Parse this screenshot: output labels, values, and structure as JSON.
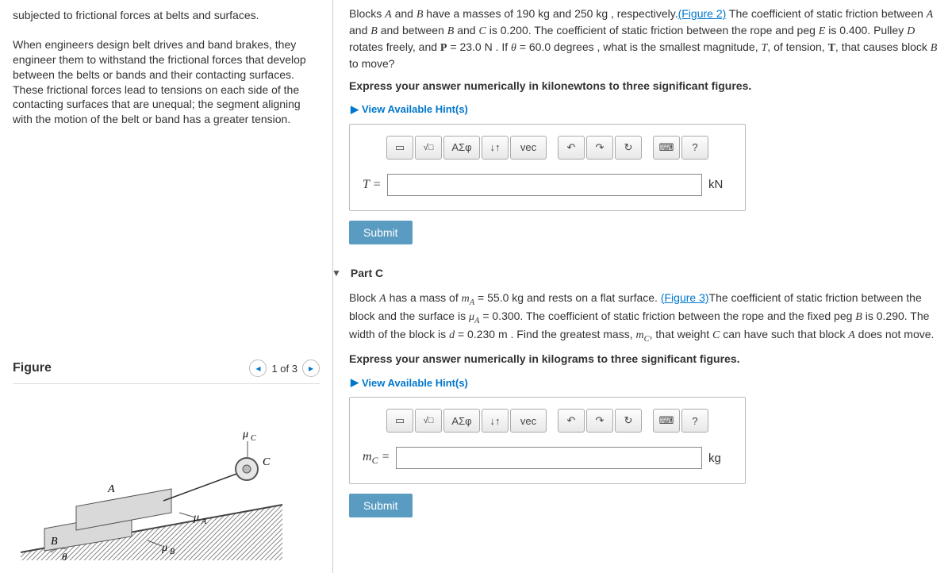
{
  "leftPanel": {
    "intro1": "subjected to frictional forces at belts and surfaces.",
    "intro2": "When engineers design belt drives and band brakes, they engineer them to withstand the frictional forces that develop between the belts or bands and their contacting surfaces. These frictional forces lead to tensions on each side of the contacting surfaces that are unequal; the segment aligning with the motion of the belt or band has a greater tension.",
    "figureTitle": "Figure",
    "pager": "1 of 3"
  },
  "partB": {
    "promptBefore": "Blocks ",
    "promptA": "A",
    "promptAndB": " and ",
    "promptB": "B",
    "promptMid1": " have a masses of 190 ",
    "kg1": "kg",
    "promptMid2": " and 250 ",
    "kg2": "kg",
    "promptMid3": " , respectively.",
    "figLink": "(Figure 2)",
    "promptMid4": " The coefficient of static friction between ",
    "promptMid5": " and between ",
    "promptC": "C",
    "promptMid6": " is 0.200. The coefficient of static friction between the rope and peg ",
    "promptE": "E",
    "promptMid7": " is 0.400. Pulley ",
    "promptD": "D",
    "promptMid8": " rotates freely, and ",
    "Pval": " = 23.0 ",
    "N": "N",
    "promptMid9": " . If ",
    "theta": "θ",
    "thetaVal": " = 60.0 ",
    "deg": "degrees",
    "promptMid10": " , what is the smallest magnitude, ",
    "Tvar": "T",
    "promptMid11": ", of tension, ",
    "promptMid12": ", that causes block ",
    "promptMid13": " to move?",
    "express": "Express your answer numerically in kilonewtons to three significant figures.",
    "hint": "View Available Hint(s)",
    "varLabel": "T =",
    "unit": "kN",
    "submit": "Submit",
    "tools": {
      "sigma": "ΑΣφ",
      "vec": "vec",
      "help": "?"
    }
  },
  "partC": {
    "title": "Part C",
    "promptBefore": "Block ",
    "A": "A",
    "p1": " has a mass of ",
    "mA": "m",
    "mAsub": "A",
    "mAval": " = 55.0 ",
    "kg": "kg",
    "p2": " and rests on a flat surface. ",
    "figLink": "(Figure 3)",
    "p3": "The coefficient of static friction between the block and the surface is ",
    "muA": "μ",
    "muAsub": "A",
    "muAval": " = 0.300. The coefficient of static friction between the rope and the fixed peg ",
    "B": "B",
    "p4": " is 0.290. The width of the block is ",
    "d": "d",
    "dval": " = 0.230 ",
    "m": "m",
    "p5": " . Find the greatest mass, ",
    "mC": "m",
    "mCsub": "C",
    "p6": ", that weight ",
    "C": "C",
    "p7": " can have such that block ",
    "p8": " does not move.",
    "express": "Express your answer numerically in kilograms to three significant figures.",
    "hint": "View Available Hint(s)",
    "varLabel": "m",
    "varSub": "C",
    "varEq": " =",
    "unit": "kg",
    "submit": "Submit"
  }
}
